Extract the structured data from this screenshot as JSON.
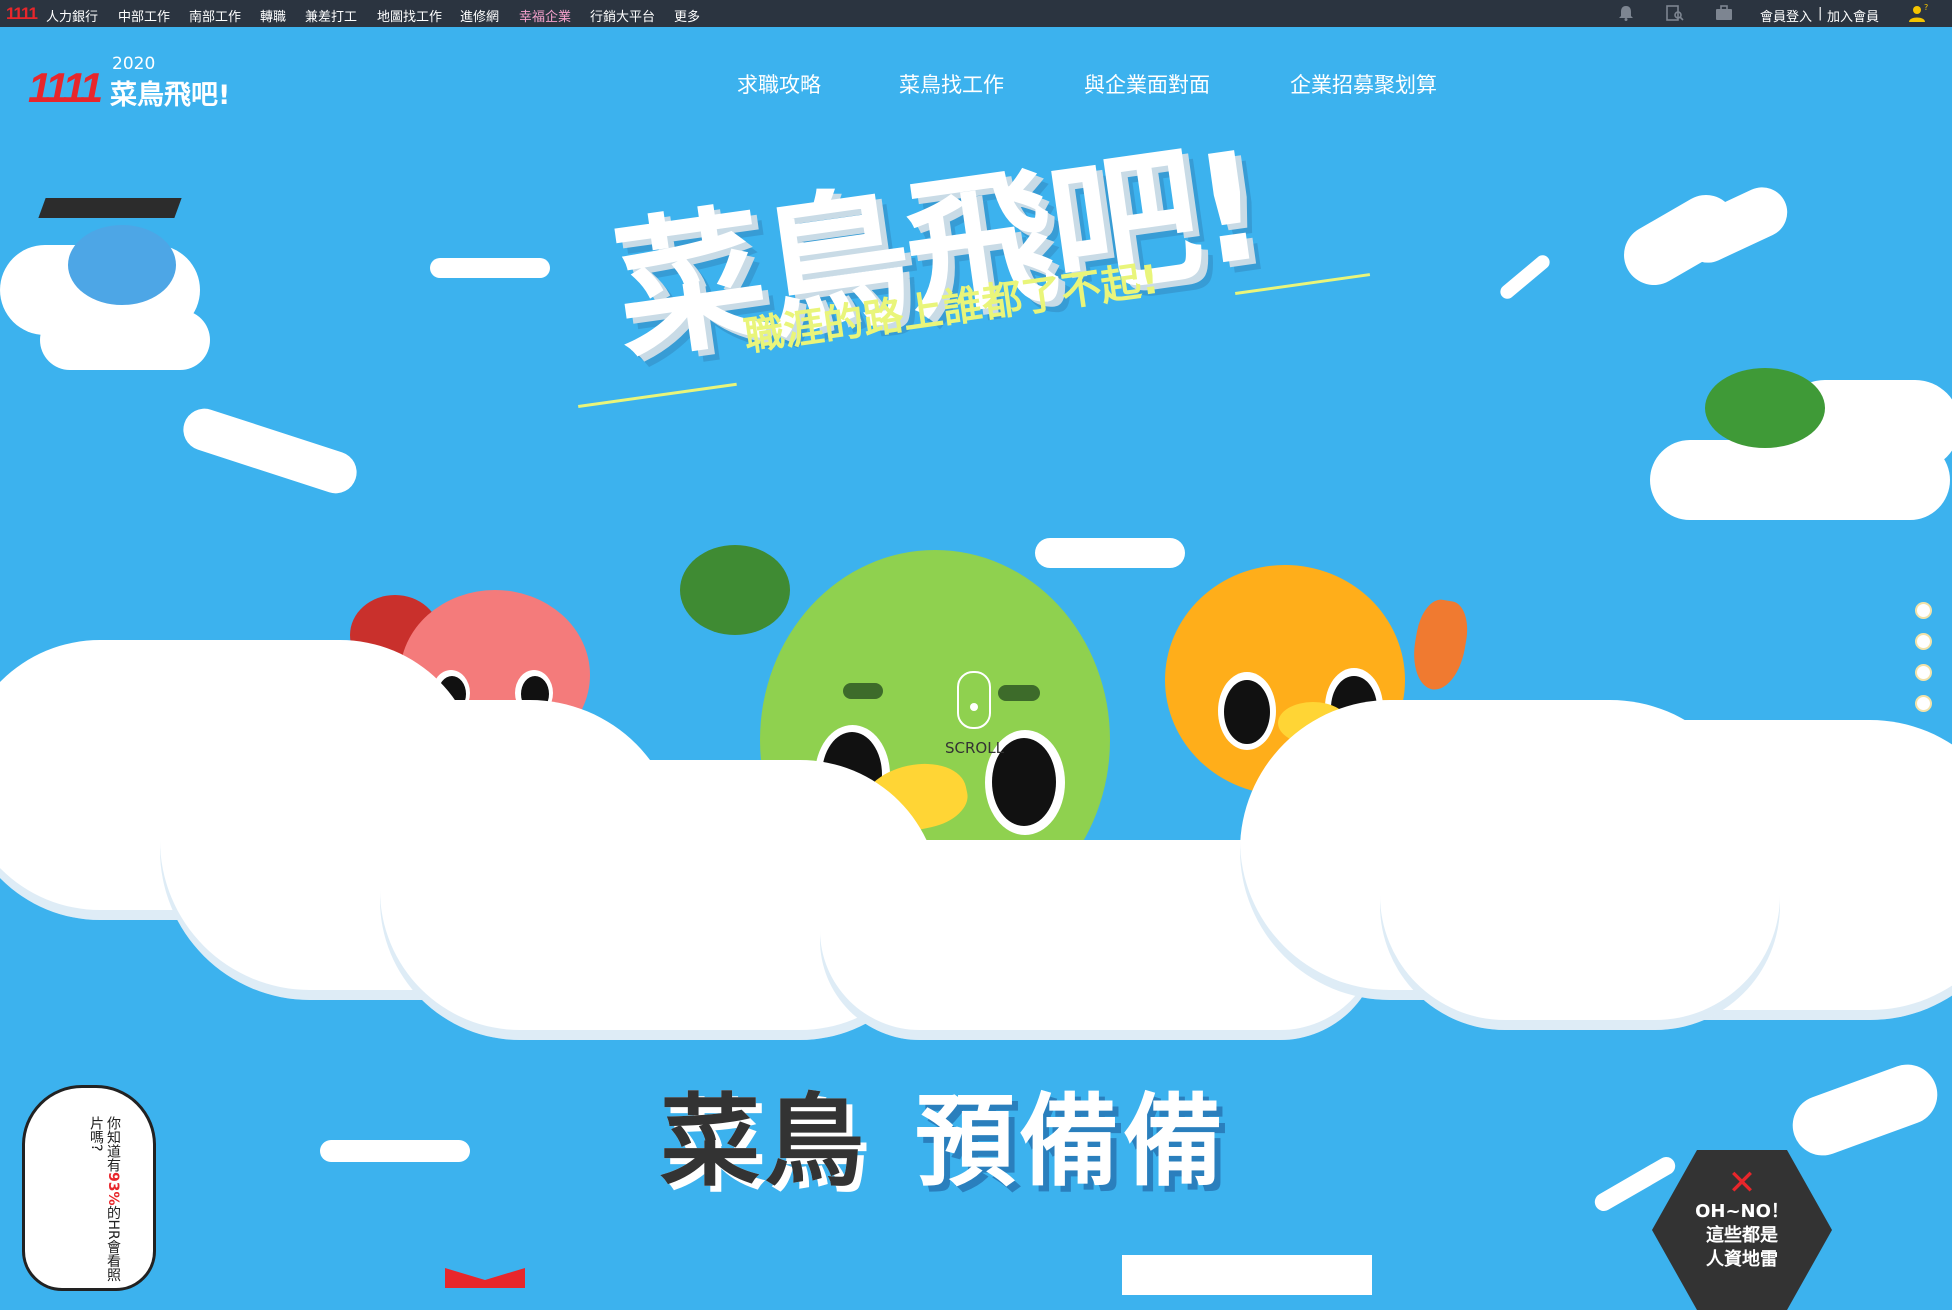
{
  "topbar": {
    "logo": "1111",
    "items": [
      "人力銀行",
      "中部工作",
      "南部工作",
      "轉職",
      "兼差打工",
      "地圖找工作",
      "進修網",
      "幸福企業",
      "行銷大平台",
      "更多"
    ],
    "member_login": "會員登入",
    "separator": "|",
    "join_member": "加入會員",
    "icons": [
      "bell-icon",
      "search-doc-icon",
      "briefcase-icon",
      "user-help-icon"
    ]
  },
  "header": {
    "logo_number": "1111",
    "logo_year": "2020",
    "logo_name": "菜鳥飛吧!",
    "nav": [
      "求職攻略",
      "菜鳥找工作",
      "與企業面對面",
      "企業招募聚划算"
    ]
  },
  "hero": {
    "title": "菜鳥飛吧!",
    "subtitle": "職涯的路上誰都了不起!",
    "scroll_label": "SCROLL"
  },
  "section": {
    "title_part1": "菜鳥",
    "title_part2": "預備備"
  },
  "bubble_left": {
    "text_a": "你知道有",
    "text_pct": "93%",
    "text_b": "的HR會看照片嗎?"
  },
  "badge_right": {
    "mark": "✕",
    "line1": "OH~NO！",
    "line2": "這些都是",
    "line3": "人資地雷"
  },
  "colors": {
    "sky": "#3cb2ee",
    "topbar": "#2b3440",
    "brand_red": "#e8262b",
    "accent_yellow": "#e9f57a"
  }
}
